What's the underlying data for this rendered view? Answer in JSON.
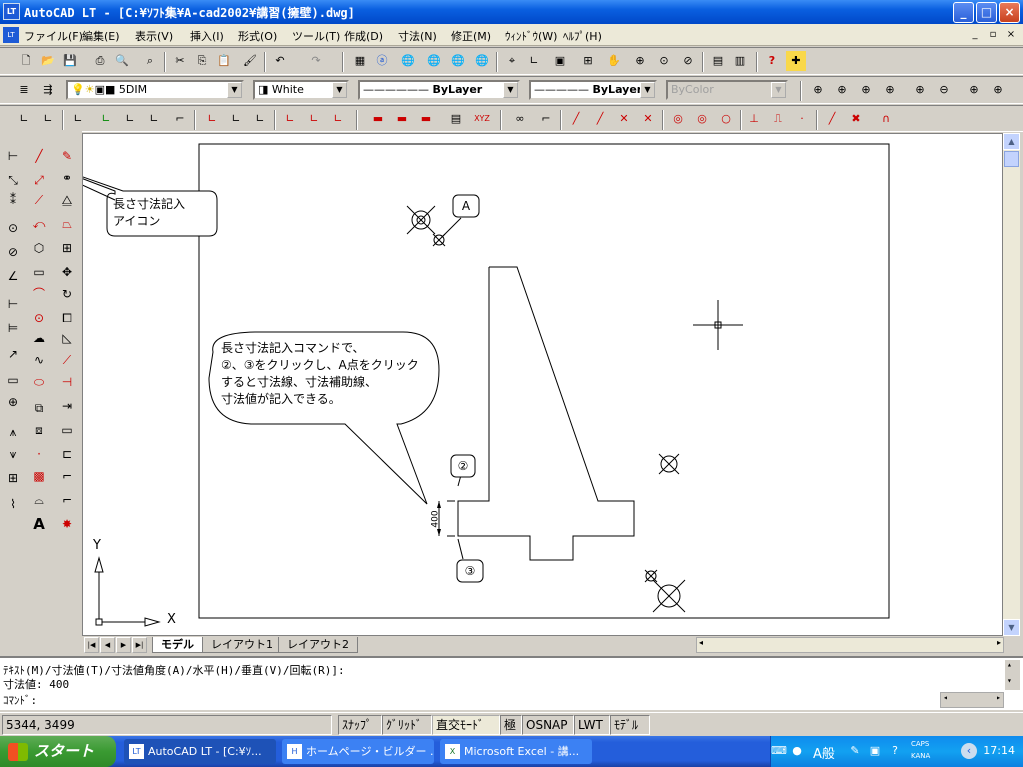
{
  "window": {
    "title": "AutoCAD LT - [C:¥ｿﾌﾄ集¥A-cad2002¥講習(擁壁).dwg]",
    "app_icon_text": "LT",
    "doc_icon_text": "LT",
    "minimize": "_",
    "maximize": "□",
    "close": "×"
  },
  "menubar": {
    "items": [
      "ファイル(F)",
      "編集(E)",
      "表示(V)",
      "挿入(I)",
      "形式(O)",
      "ツール(T)",
      "作成(D)",
      "寸法(N)",
      "修正(M)",
      "ｳｨﾝﾄﾞｳ(W)",
      "ﾍﾙﾌﾟ(H)"
    ],
    "mdi_min": "_",
    "mdi_restore": "▫",
    "mdi_close": "×"
  },
  "properties_toolbar": {
    "layer": "5DIM",
    "color": "White",
    "linetype": "ByLayer",
    "lineweight": "ByLayer",
    "plotstyle": "ByColor",
    "dropdown_arrow": "▼"
  },
  "drawing": {
    "callout_icon_text": [
      "長さ寸法記入",
      "アイコン"
    ],
    "callout_command_text": [
      "長さ寸法記入コマンドで、",
      "②、③をクリックし、A点をクリック",
      "すると寸法線、寸法補助線、",
      "寸法値が記入できる。"
    ],
    "label_a": "A",
    "label_2": "②",
    "label_3": "③",
    "dim_value": "400",
    "ucs_y": "Y",
    "ucs_x": "X"
  },
  "layout_tabs": {
    "nav": [
      "|◀",
      "◀",
      "▶",
      "▶|"
    ],
    "tabs": [
      "モデル",
      "レイアウト1",
      "レイアウト2"
    ],
    "active": "モデル"
  },
  "command_line": {
    "line1": "ﾃｷｽﾄ(M)/寸法値(T)/寸法値角度(A)/水平(H)/垂直(V)/回転(R)]:",
    "line2": "寸法値: 400",
    "prompt": "ｺﾏﾝﾄﾞ:"
  },
  "status_bar": {
    "coords": "5344,  3499",
    "snap": "ｽﾅｯﾌﾟ",
    "grid": "ｸﾞﾘｯﾄﾞ",
    "ortho": "直交ﾓｰﾄﾞ",
    "polar": "極",
    "osnap": "OSNAP",
    "lwt": "LWT",
    "model": "ﾓﾃﾞﾙ"
  },
  "taskbar": {
    "start": "スタート",
    "items": [
      {
        "label": "AutoCAD LT - [C:¥ｿ...",
        "icon": "LT"
      },
      {
        "label": "ホームページ・ビルダー ...",
        "icon": "H"
      },
      {
        "label": "Microsoft Excel - 講...",
        "icon": "X"
      }
    ],
    "ime": "A般",
    "caps": "CAPS",
    "kana": "KANA",
    "clock": "17:14"
  },
  "colors": {
    "titlebar": "#0a5fe0",
    "taskbar": "#245edb",
    "start_button": "#3a9a32",
    "toolbar_face": "#d4d0c8"
  }
}
